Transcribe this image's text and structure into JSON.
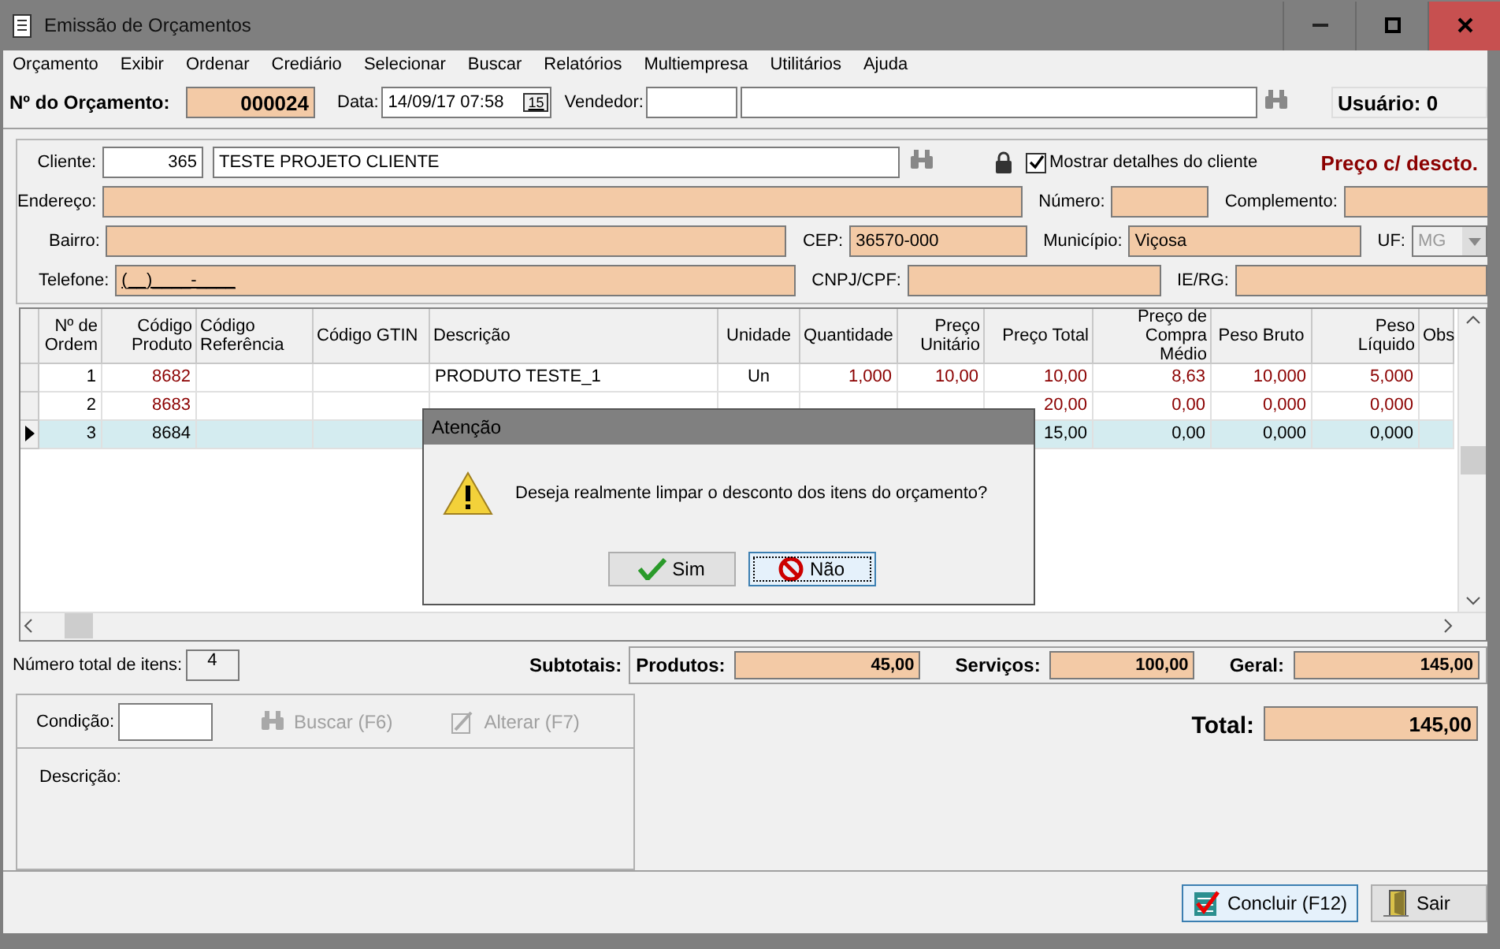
{
  "window": {
    "title": "Emissão de Orçamentos"
  },
  "menu": [
    "Orçamento",
    "Exibir",
    "Ordenar",
    "Crediário",
    "Selecionar",
    "Buscar",
    "Relatórios",
    "Multiempresa",
    "Utilitários",
    "Ajuda"
  ],
  "header": {
    "number_label": "Nº do Orçamento:",
    "number": "000024",
    "date_label": "Data:",
    "date": "14/09/17 07:58",
    "calendar": "15",
    "seller_label": "Vendedor:",
    "user": "Usuário: 0"
  },
  "client": {
    "label": "Cliente:",
    "code": "365",
    "name": "TESTE PROJETO CLIENTE",
    "show_details": {
      "label": "Mostrar detalhes do cliente",
      "checked": true
    },
    "price_mode": "Preço c/ descto.",
    "rows": [
      [
        {
          "label": "Endereço:"
        },
        {
          "label": "Número:"
        },
        {
          "label": "Complemento:"
        }
      ],
      [
        {
          "label": "Bairro:"
        },
        {
          "label": "CEP:",
          "value": "36570-000"
        },
        {
          "label": "Município:",
          "value": "Viçosa"
        },
        {
          "label": "UF:",
          "value": "MG",
          "kind": "combo",
          "disabled": true
        }
      ],
      [
        {
          "label": "Telefone:",
          "value": "(__)____-____"
        },
        {
          "label": "CNPJ/CPF:"
        },
        {
          "label": "IE/RG:"
        }
      ]
    ]
  },
  "grid": {
    "columns": [
      "Nº de Ordem",
      "Código Produto",
      "Código Referência",
      "Código GTIN",
      "Descrição",
      "Unidade",
      "Quantidade",
      "Preço Unitário",
      "Preço Total",
      "Preço de Compra Médio",
      "Peso Bruto",
      "Peso Líquido",
      "Obs"
    ],
    "rows": [
      {
        "selected": false,
        "cells": [
          "1",
          "8682",
          null,
          null,
          "PRODUTO TESTE_1",
          "Un",
          "1,000",
          "10,00",
          "10,00",
          "8,63",
          "10,000",
          "5,000",
          null
        ]
      },
      {
        "selected": false,
        "cells": [
          "2",
          "8683",
          null,
          null,
          null,
          null,
          null,
          null,
          "20,00",
          "0,00",
          "0,000",
          "0,000",
          null
        ]
      },
      {
        "selected": true,
        "cells": [
          "3",
          "8684",
          null,
          null,
          null,
          null,
          null,
          null,
          "15,00",
          "0,00",
          "0,000",
          "0,000",
          null
        ]
      }
    ]
  },
  "totals": {
    "items_label": "Número total de itens:",
    "items": "4",
    "subtotals_label": "Subtotais:",
    "parts": [
      {
        "label": "Produtos:",
        "value": "45,00"
      },
      {
        "label": "Serviços:",
        "value": "100,00"
      },
      {
        "label": "Geral:",
        "value": "145,00"
      }
    ],
    "total_label": "Total:",
    "total": "145,00"
  },
  "payment": {
    "condition_label": "Condição:",
    "search": {
      "label": "Buscar (F6)",
      "disabled": true
    },
    "change": {
      "label": "Alterar (F7)",
      "disabled": true
    },
    "description_label": "Descrição:"
  },
  "footer": [
    {
      "label": "Concluir (F12)",
      "kind": "confirm",
      "focused": true
    },
    {
      "label": "Sair",
      "kind": "exit",
      "focused": false
    }
  ],
  "dialog": {
    "title": "Atenção",
    "message": "Deseja realmente limpar o desconto dos itens do orçamento?",
    "buttons": [
      {
        "label": "Sim",
        "kind": "yes",
        "focused": false
      },
      {
        "label": "Não",
        "kind": "no",
        "focused": true
      }
    ]
  }
}
